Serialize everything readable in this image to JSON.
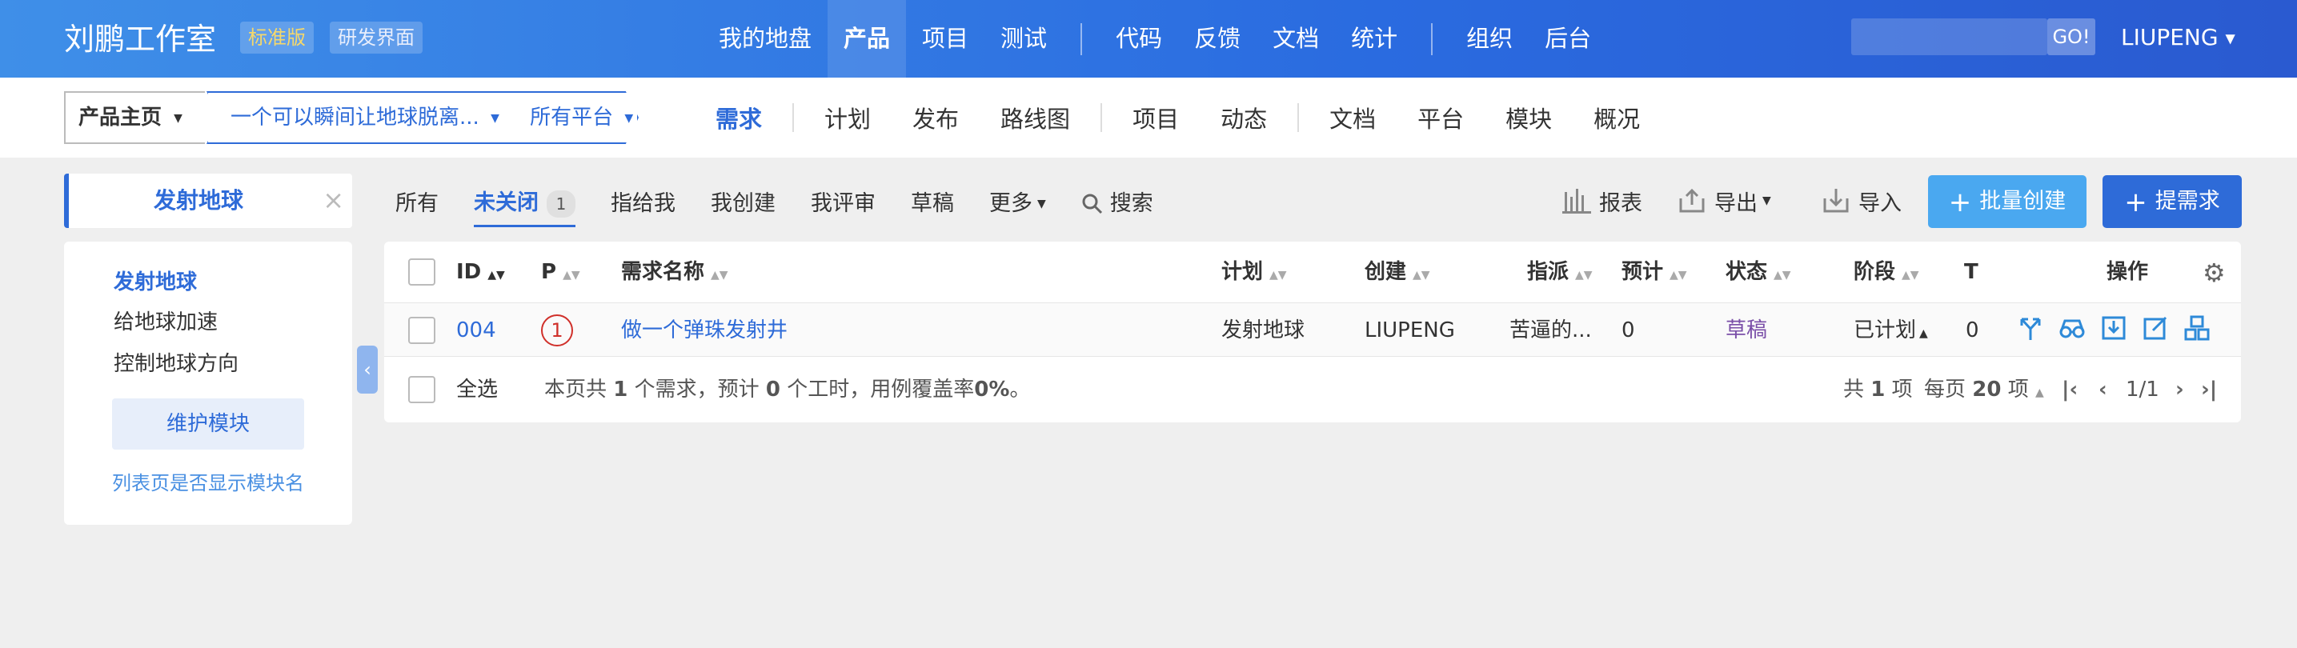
{
  "header": {
    "brand": "刘鹏工作室",
    "tag_edition": "标准版",
    "tag_ui": "研发界面",
    "nav": [
      "我的地盘",
      "产品",
      "项目",
      "测试",
      "代码",
      "反馈",
      "文档",
      "统计",
      "组织",
      "后台"
    ],
    "nav_active": "产品",
    "search_go": "GO!",
    "user": "LIUPENG"
  },
  "subheader": {
    "crumb_home": "产品主页",
    "crumb_product": "一个可以瞬间让地球脱离...",
    "crumb_platform": "所有平台",
    "nav": [
      "需求",
      "计划",
      "发布",
      "路线图",
      "项目",
      "动态",
      "文档",
      "平台",
      "模块",
      "概况"
    ],
    "nav_active": "需求"
  },
  "sidebar": {
    "module_tab": "发射地球",
    "items": [
      "发射地球",
      "给地球加速",
      "控制地球方向"
    ],
    "maintain_button": "维护模块",
    "show_module_link": "列表页是否显示模块名"
  },
  "filters": {
    "all": "所有",
    "unclosed": "未关闭",
    "unclosed_count": "1",
    "assigned_to_me": "指给我",
    "created_by_me": "我创建",
    "reviewed_by_me": "我评审",
    "draft": "草稿",
    "more": "更多",
    "search": "搜索"
  },
  "actions": {
    "report": "报表",
    "export": "导出",
    "import": "导入",
    "batch_create": "批量创建",
    "create": "提需求"
  },
  "table": {
    "headers": {
      "id": "ID",
      "pri": "P",
      "title": "需求名称",
      "plan": "计划",
      "creator": "创建",
      "assigned": "指派",
      "estimate": "预计",
      "status": "状态",
      "stage": "阶段",
      "t": "T",
      "actions": "操作"
    },
    "rows": [
      {
        "id": "004",
        "pri": "1",
        "title": "做一个弹珠发射井",
        "plan": "发射地球",
        "creator": "LIUPENG",
        "assigned": "苦逼的...",
        "estimate": "0",
        "status": "草稿",
        "stage": "已计划",
        "t": "0"
      }
    ],
    "footer": {
      "select_all": "全选",
      "summary_prefix": "本页共",
      "summary_count": "1",
      "summary_mid1": "个需求，预计",
      "summary_hours": "0",
      "summary_mid2": "个工时，用例覆盖率",
      "summary_coverage": "0%",
      "summary_end": "。",
      "total_prefix": "共",
      "total_count": "1",
      "total_suffix": "项",
      "per_page_prefix": "每页",
      "per_page": "20",
      "per_page_suffix": "项",
      "page": "1/1"
    }
  },
  "colors": {
    "primary": "#2e6bd8",
    "header_start": "#3f8fe8",
    "header_end": "#2a5ad0",
    "batch_button": "#4aa8f0",
    "priority": "#d0302a",
    "status_draft": "#7a4fa8"
  }
}
